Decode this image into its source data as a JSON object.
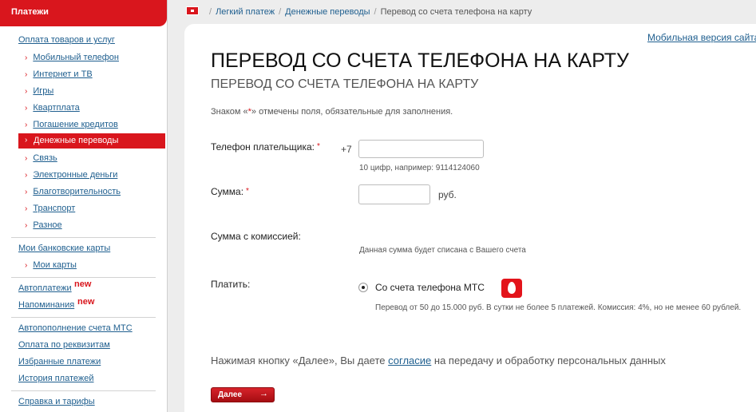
{
  "sidebar": {
    "header": "Платежи",
    "section1": "Оплата товаров и услуг",
    "sub_items": [
      "Мобильный телефон",
      "Интернет и ТВ",
      "Игры",
      "Квартплата",
      "Погашение кредитов",
      "Денежные переводы",
      "Связь",
      "Электронные деньги",
      "Благотворительность",
      "Транспорт",
      "Разное"
    ],
    "arrow": "›",
    "bank_cards": "Мои банковские карты",
    "my_cards": "Мои карты",
    "autopay": "Автоплатежи",
    "reminders": "Напоминания",
    "new_badge": "new",
    "autofill": "Автопополнение счета МТС",
    "requisites": "Оплата по реквизитам",
    "favorites": "Избранные платежи",
    "history": "История платежей",
    "help": "Справка и тарифы"
  },
  "breadcrumb": {
    "sep": "/",
    "items": [
      "Легкий платеж",
      "Денежные переводы",
      "Перевод со счета телефона на карту"
    ]
  },
  "mobile_link": "Мобильная версия сайта",
  "page": {
    "title": "ПЕРЕВОД СО СЧЕТА ТЕЛЕФОНА НА КАРТУ",
    "subtitle": "ПЕРЕВОД СО СЧЕТА ТЕЛЕФОНА НА КАРТУ",
    "note_prefix": "Знаком «",
    "note_star": "*",
    "note_suffix": "» отмечены поля, обязательные для заполнения."
  },
  "form": {
    "required_mark": "*",
    "phone_label": "Телефон плательщика:",
    "phone_prefix": "+7",
    "phone_value": "",
    "phone_hint": "10 цифр, например: 9114124060",
    "amount_label": "Сумма:",
    "amount_value": "",
    "amount_unit": "руб.",
    "commission_label": "Сумма с комиссией:",
    "commission_hint": "Данная сумма будет списана с Вашего счета",
    "pay_label": "Платить:",
    "pay_option": "Со счета телефона МТС",
    "pay_desc": "Перевод от 50 до 15.000 руб. В сутки не более 5 платежей. Комиссия: 4%, но не менее 60 рублей."
  },
  "consent": {
    "before": "Нажимая кнопку «Далее», Вы даете ",
    "link": "согласие",
    "after": " на передачу и обработку персональных данных"
  },
  "next_button": {
    "label": "Далее",
    "arrow": "→"
  },
  "colors": {
    "brand_red": "#d9161d",
    "link": "#1f5f8f"
  }
}
